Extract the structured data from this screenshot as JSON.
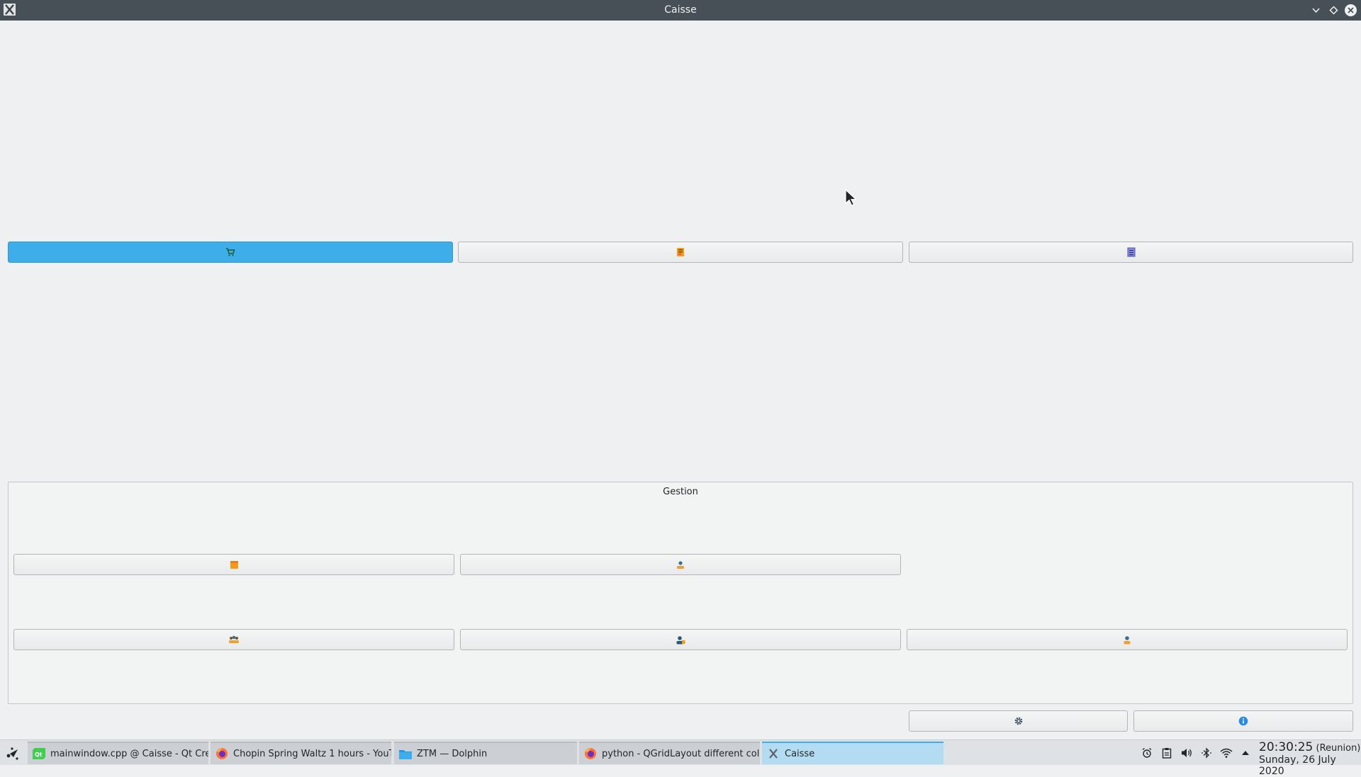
{
  "window": {
    "title": "Caisse",
    "controls": [
      "chevron-down-icon",
      "diamond-icon",
      "close-icon"
    ]
  },
  "main": {
    "top_buttons": [
      {
        "icon": "cart-icon",
        "active": true
      },
      {
        "icon": "receipt-icon",
        "active": false
      },
      {
        "icon": "list-document-icon",
        "active": false
      }
    ]
  },
  "gestion": {
    "title": "Gestion",
    "row1": [
      {
        "icon": "box-icon"
      },
      {
        "icon": "supplier-icon"
      }
    ],
    "row2": [
      {
        "icon": "users-group-icon"
      },
      {
        "icon": "user-card-icon"
      },
      {
        "icon": "user-icon"
      }
    ]
  },
  "footer_buttons": [
    {
      "icon": "gear-icon"
    },
    {
      "icon": "info-icon"
    }
  ],
  "taskbar": {
    "tasks": [
      {
        "label": "mainwindow.cpp @ Caisse - Qt Cre...",
        "icon": "qt-creator-icon"
      },
      {
        "label": "Chopin Spring Waltz 1 hours - YouT...",
        "icon": "firefox-icon"
      },
      {
        "label": "ZTM — Dolphin",
        "icon": "folder-icon"
      },
      {
        "label": "python - QGridLayout different col...",
        "icon": "firefox-icon"
      },
      {
        "label": "Caisse",
        "icon": "x-app-icon"
      }
    ],
    "tray": [
      "alarm-icon",
      "clipboard-icon",
      "volume-icon",
      "bluetooth-icon",
      "wifi-icon",
      "chevron-up-icon"
    ],
    "clock": {
      "time": "20:30:25",
      "timezone": "(Reunion)",
      "date": "Sunday, 26 July 2020"
    }
  },
  "colors": {
    "accent": "#3daee9",
    "titlebar": "#475057",
    "window_bg": "#eff0f1"
  }
}
